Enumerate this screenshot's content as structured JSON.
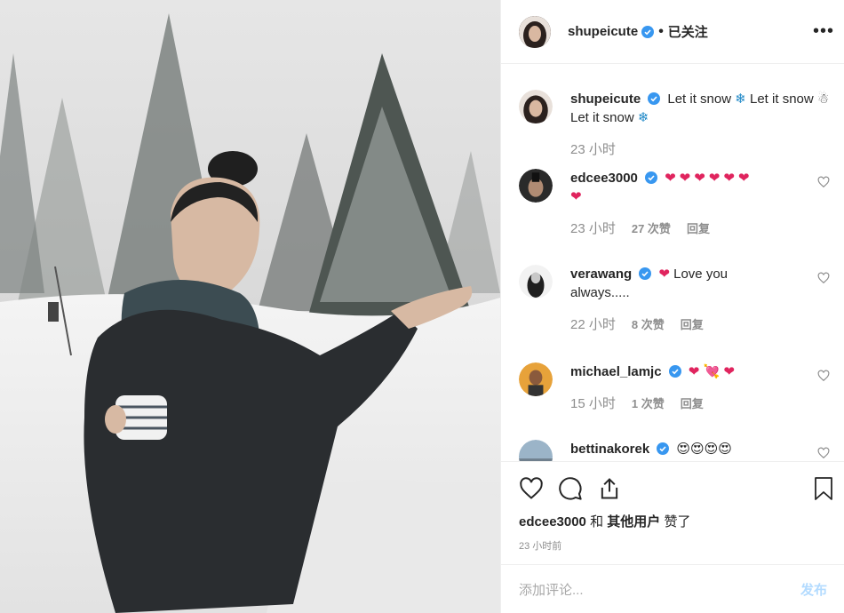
{
  "header": {
    "username": "shupeicute",
    "separator": "•",
    "follow_label": "已关注",
    "more_label": "•••"
  },
  "caption": {
    "username": "shupeicute",
    "text_1": "Let it snow",
    "text_2": "Let it",
    "text_3": "snow",
    "text_4": "Let it snow",
    "time": "23 小时"
  },
  "comments": [
    {
      "username": "edcee3000",
      "hearts_line1": "❤❤❤❤❤❤",
      "hearts_line2": "❤",
      "time": "23 小时",
      "likes": "27 次赞",
      "reply": "回复"
    },
    {
      "username": "verawang",
      "text": "Love you",
      "text_2": "always.....",
      "time": "22 小时",
      "likes": "8 次赞",
      "reply": "回复"
    },
    {
      "username": "michael_lamjc",
      "time": "15 小时",
      "likes": "1 次赞",
      "reply": "回复"
    },
    {
      "username": "bettinakorek"
    }
  ],
  "footer": {
    "liked_user": "edcee3000",
    "liked_and": "和",
    "liked_others": "其他用户",
    "liked_suffix": "赞了",
    "time": "23 小时前",
    "comment_placeholder": "添加评论...",
    "post_label": "发布"
  },
  "colors": {
    "verified": "#3897f0",
    "heart": "#e0245e",
    "text": "#262626",
    "muted": "#8e8e8e",
    "post_disabled": "#b3dbff"
  }
}
